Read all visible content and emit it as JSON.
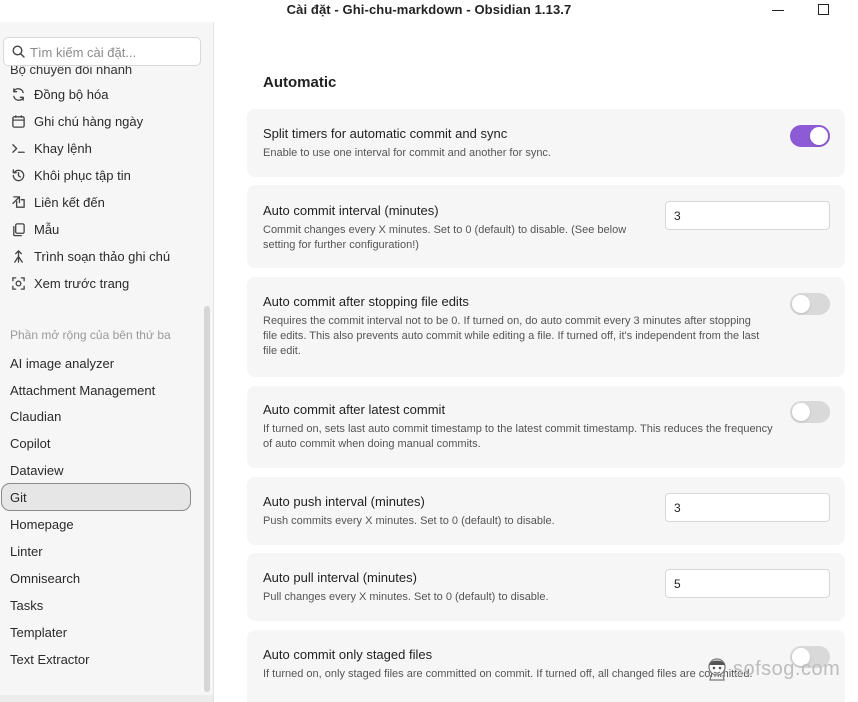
{
  "window": {
    "title": "Cài đặt - Ghi-chu-markdown - Obsidian 1.13.7"
  },
  "sidebar": {
    "search_placeholder": "Tìm kiếm cài đặt...",
    "cut_item": "Bộ chuyển đổi nhanh",
    "core_items": [
      {
        "label": "Đồng bộ hóa",
        "icon": "sync-icon"
      },
      {
        "label": "Ghi chú hàng ngày",
        "icon": "calendar-icon"
      },
      {
        "label": "Khay lệnh",
        "icon": "terminal-icon"
      },
      {
        "label": "Khôi phục tập tin",
        "icon": "history-icon"
      },
      {
        "label": "Liên kết đến",
        "icon": "link-icon"
      },
      {
        "label": "Mẫu",
        "icon": "template-icon"
      },
      {
        "label": "Trình soạn thảo ghi chú",
        "icon": "editor-icon"
      },
      {
        "label": "Xem trước trang",
        "icon": "preview-icon"
      }
    ],
    "section_label": "Phần mở rộng của bên thứ ba",
    "plugins": [
      "AI image analyzer",
      "Attachment Management",
      "Claudian",
      "Copilot",
      "Dataview",
      "Git",
      "Homepage",
      "Linter",
      "Omnisearch",
      "Tasks",
      "Templater",
      "Text Extractor"
    ],
    "active_plugin": "Git"
  },
  "main": {
    "heading": "Automatic",
    "settings": [
      {
        "name": "Split timers for automatic commit and sync",
        "desc": "Enable to use one interval for commit and another for sync.",
        "control": "toggle",
        "on": true
      },
      {
        "name": "Auto commit interval (minutes)",
        "desc": "Commit changes every X minutes. Set to 0 (default) to disable. (See below setting for further configuration!)",
        "control": "input",
        "value": "3"
      },
      {
        "name": "Auto commit after stopping file edits",
        "desc": "Requires the commit interval not to be 0. If turned on, do auto commit every 3 minutes after stopping file edits. This also prevents auto commit while editing a file. If turned off, it's independent from the last file edit.",
        "control": "toggle",
        "on": false
      },
      {
        "name": "Auto commit after latest commit",
        "desc": "If turned on, sets last auto commit timestamp to the latest commit timestamp. This reduces the frequency of auto commit when doing manual commits.",
        "control": "toggle",
        "on": false
      },
      {
        "name": "Auto push interval (minutes)",
        "desc": "Push commits every X minutes. Set to 0 (default) to disable.",
        "control": "input",
        "value": "3"
      },
      {
        "name": "Auto pull interval (minutes)",
        "desc": "Pull changes every X minutes. Set to 0 (default) to disable.",
        "control": "input",
        "value": "5"
      },
      {
        "name": "Auto commit only staged files",
        "desc": "If turned on, only staged files are committed on commit. If turned off, all changed files are committed.",
        "control": "toggle",
        "on": false
      }
    ]
  },
  "watermark": {
    "text": "sofsog.com"
  },
  "colors": {
    "accent": "#8e5bd6",
    "card_bg": "#f6f6f6",
    "sidebar_bg": "#f6f6f6"
  }
}
